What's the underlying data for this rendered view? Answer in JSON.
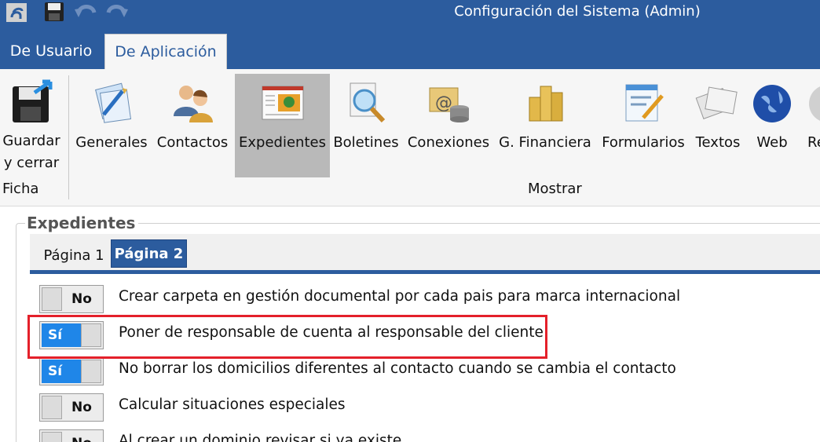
{
  "window": {
    "title": "Configuración del Sistema (Admin)"
  },
  "quick_access": {
    "icons": [
      "app-logo-icon",
      "save-icon",
      "undo-icon",
      "redo-icon"
    ]
  },
  "tabs": [
    {
      "label": "De Usuario",
      "active": false
    },
    {
      "label": "De Aplicación",
      "active": true
    }
  ],
  "ribbon": {
    "groups": [
      {
        "label": "Ficha",
        "buttons": [
          {
            "label_line1": "Guardar",
            "label_line2": "y cerrar",
            "icon": "floppy-save-close-icon"
          }
        ]
      },
      {
        "label": "Mostrar",
        "buttons": [
          {
            "label": "Generales",
            "icon": "general-settings-icon"
          },
          {
            "label": "Contactos",
            "icon": "contacts-icon"
          },
          {
            "label": "Expedientes",
            "icon": "dossiers-icon",
            "active": true
          },
          {
            "label": "Boletines",
            "icon": "bulletins-search-icon"
          },
          {
            "label": "Conexiones",
            "icon": "connections-icon"
          },
          {
            "label": "G. Financiera",
            "icon": "finance-coins-icon"
          },
          {
            "label": "Formularios",
            "icon": "forms-icon"
          },
          {
            "label": "Textos",
            "icon": "texts-icon"
          },
          {
            "label": "Web",
            "icon": "globe-icon"
          },
          {
            "label": "Re",
            "icon": "partial-icon"
          }
        ]
      }
    ]
  },
  "section": {
    "title": "Expedientes",
    "subtabs": [
      {
        "label": "Página 1",
        "active": false
      },
      {
        "label": "Página 2",
        "active": true
      }
    ],
    "options": [
      {
        "state": "No",
        "on": false,
        "label": "Crear carpeta en gestión documental por cada pais para marca internacional"
      },
      {
        "state": "Sí",
        "on": true,
        "label": "Poner de responsable de cuenta al responsable del cliente",
        "highlighted": true
      },
      {
        "state": "Sí",
        "on": true,
        "label": "No borrar los domicilios diferentes al contacto cuando se cambia el contacto"
      },
      {
        "state": "No",
        "on": false,
        "label": "Calcular situaciones especiales"
      },
      {
        "state": "No",
        "on": false,
        "label": "Al crear un dominio revisar si ya existe"
      }
    ]
  },
  "colors": {
    "brand_blue": "#2c5c9e",
    "toggle_on": "#1f86e8",
    "highlight_red": "#e4202a"
  }
}
